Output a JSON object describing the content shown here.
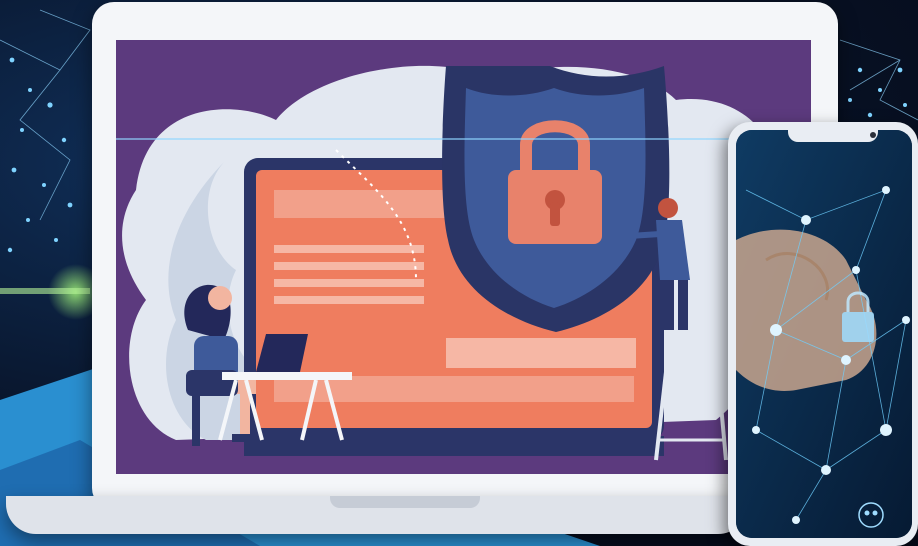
{
  "scene": {
    "description_icons": [
      "shield-icon",
      "padlock-icon",
      "user-node-icon"
    ],
    "colors": {
      "screen_bg": "#5c3a7e",
      "shield_dark": "#2a3566",
      "shield_mid": "#3e5a9a",
      "lock": "#e8826b",
      "monitor": "#ef7d5f",
      "monitor_frame": "#2b3568",
      "cloud": "#e3e8f1",
      "person_hair": "#23285a",
      "network_blue": "#5ec8f0"
    }
  }
}
